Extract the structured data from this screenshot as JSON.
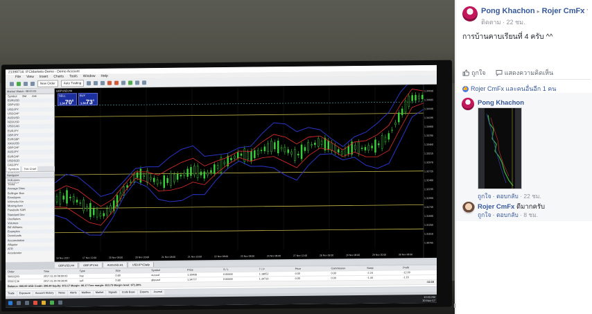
{
  "post": {
    "author": "Pong Khachon",
    "target": "Rojer CmFx",
    "follow": "ติดตาม",
    "time": "· 22 ชม.",
    "more": "···",
    "text": "การบ้านคาบเรียนที่ 4 ครับ ^^",
    "like_label": "ถูกใจ",
    "comment_label": "แสดงความคิดเห็น",
    "reactions_text": "Rojer CmFx และคนอื่นอีก 1 คน"
  },
  "comments": [
    {
      "author": "Pong Khachon",
      "text": "",
      "like": "ถูกใจ",
      "reply": "ตอบกลับ",
      "time": "· 22 ชม."
    },
    {
      "author": "Rojer CmFx",
      "text": "ดีมากครับ",
      "like": "ถูกใจ",
      "reply": "ตอบกลับ",
      "time": "· 8 ชม."
    }
  ],
  "photo": {
    "window_title": "21398716: IFCMarkets-Demo - Demo Account",
    "menu": [
      "File",
      "View",
      "Insert",
      "Charts",
      "Tools",
      "Window",
      "Help"
    ],
    "toolbar": {
      "new_order": "New Order",
      "auto_trading": "Auto Trading"
    },
    "market_watch_header": "Market Watch: 08:00:03",
    "market_columns": [
      "Symbol",
      "Bid",
      "Ask"
    ],
    "symbols": [
      "EURUSD",
      "GBPUSD",
      "USDJPY",
      "USDCHF",
      "AUDUSD",
      "NZDUSD",
      "USDCAD",
      "EURJPY",
      "GBPJPY",
      "EURGBP",
      "XAUUSD",
      "GBPCHF",
      "AUDJPY",
      "EURCHF",
      "USDSGD",
      "CADJPY",
      "CHFJPY",
      "AUDCAD",
      "NZDJPY",
      "AUDNZD"
    ],
    "nav_tabs": [
      "Symbols",
      "Tick Chart"
    ],
    "navigator_header": "Navigator",
    "navigator_items": [
      "Indicators",
      "Trend",
      "Average Direc",
      "Bollinger Ban",
      "Envelopes",
      "Ichimoku Kin",
      "Moving Aver",
      "Parabolic SAR",
      "Standard Dev",
      "Oscillators",
      "Volumes",
      "Bill Williams",
      "Examples",
      "Downloads",
      "Accumulation",
      "Alligator",
      "ATR",
      "Accelerator"
    ],
    "chart_symbol": "GBPUSD,H4",
    "sell_label": "SELL",
    "buy_label": "BUY",
    "sell_price_prefix": "1.34",
    "sell_price_big": "70",
    "sell_price_sup": "8",
    "buy_price_prefix": "1.34",
    "buy_price_big": "73",
    "buy_price_sup": "1",
    "chart_tabs": [
      "GBPUSD,H4",
      "GBPJPY,H4",
      "AUDUSD,H1",
      "USDJPY,Daily"
    ],
    "price_scale": [
      "1.34930",
      "1.34685",
      "1.34440",
      "1.34195",
      "1.33950",
      "1.33705",
      "1.33460",
      "1.33215",
      "1.32970",
      "1.32725",
      "1.32480",
      "1.32235",
      "1.31990",
      "1.31745",
      "1.31500",
      "1.31255",
      "1.31010",
      "1.30765"
    ],
    "time_labels": [
      "16 Nov 2017",
      "17 Nov 12:00",
      "20 Nov 08:00",
      "20 Nov 20:00",
      "21 Nov 08:00",
      "21 Nov 20:00",
      "22 Nov 08:00",
      "23 Nov 08:00",
      "24 Nov 08:00",
      "27 Nov 12:00",
      "28 Nov 08:00",
      "29 Nov 08:00",
      "29 Nov 20:00",
      "30 Nov 08:00"
    ],
    "terminal_columns": [
      "Order",
      "Time",
      "Type",
      "Size",
      "Symbol",
      "Price",
      "S / L",
      "T / P",
      "Price",
      "Commission",
      "Swap",
      "Profit"
    ],
    "orders": [
      [
        "56693263",
        "2017.11.29 08:00:03",
        "buy",
        "0.80",
        "eurusd",
        "1.18408",
        "0.00000",
        "1.18652",
        "0.00",
        "0.00",
        "-2.24",
        "-12.00"
      ],
      [
        "55567136",
        "2017.11.29 09:28:06",
        "sell",
        "0.80",
        "gbpusd",
        "1.34777",
        "0.00000",
        "1.34716",
        "0.00",
        "0.00",
        "-1.44",
        "-1.16"
      ]
    ],
    "balance_line": "Balance: 600.00 USD  Credit: 299.99  Equity: 872.17  Margin: 96.17  Free margin: 813.73  Margin level: 971.39%",
    "balance_profit": "-12.16",
    "terminal_tabs": [
      "Trade",
      "Exposure",
      "Account History",
      "News",
      "Alerts",
      "Mailbox",
      "Market",
      "Signals",
      "Code Base",
      "Experts",
      "Journal"
    ],
    "clock_time": "10:03 AM",
    "clock_date": "30-Nov-17"
  },
  "chart_data": {
    "type": "line",
    "title": "GBPUSD,H4",
    "series": [
      {
        "values": [
          1.3198,
          1.3205,
          1.3188,
          1.3165,
          1.315,
          1.3178,
          1.3225,
          1.3263,
          1.3258,
          1.324,
          1.325,
          1.3262,
          1.3275,
          1.326,
          1.3282,
          1.33,
          1.3318,
          1.3312,
          1.333,
          1.3342,
          1.333,
          1.3312,
          1.3338,
          1.335,
          1.3338,
          1.3318,
          1.3335,
          1.333,
          1.3338,
          1.336,
          1.342,
          1.347,
          1.3473
        ]
      }
    ],
    "ylim": [
      1.305,
      1.35
    ]
  }
}
